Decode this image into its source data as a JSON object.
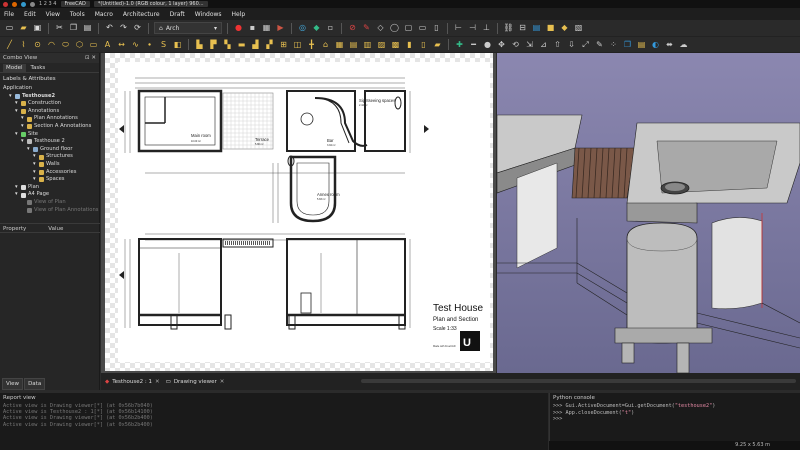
{
  "system_bar": {
    "workspace": "1 2 3 4",
    "tasks": [
      "FreeCAD",
      "*(Untitled)-1.0 (RGB colour, 1 layer) 960..."
    ]
  },
  "menu": [
    "File",
    "Edit",
    "View",
    "Tools",
    "Macro",
    "Architecture",
    "Draft",
    "Windows",
    "Help"
  ],
  "toolbar": {
    "workbench": "Arch"
  },
  "combo_view": {
    "title": "Combo View",
    "tabs": [
      "Model",
      "Tasks"
    ],
    "section": "Labels & Attributes",
    "tree": [
      {
        "label": "Application",
        "level": 0,
        "icon": "none",
        "state": ""
      },
      {
        "label": "Testhouse2",
        "level": 1,
        "icon": "document",
        "state": "sel-bold"
      },
      {
        "label": "Construction",
        "level": 2,
        "icon": "folder",
        "state": ""
      },
      {
        "label": "Annotations",
        "level": 2,
        "icon": "folder",
        "state": ""
      },
      {
        "label": "Plan Annotations",
        "level": 3,
        "icon": "folder",
        "state": ""
      },
      {
        "label": "Section A Annotations",
        "level": 3,
        "icon": "folder",
        "state": ""
      },
      {
        "label": "Site",
        "level": 2,
        "icon": "site",
        "state": ""
      },
      {
        "label": "Testhouse 2",
        "level": 3,
        "icon": "building",
        "state": ""
      },
      {
        "label": "Ground floor",
        "level": 4,
        "icon": "floor",
        "state": ""
      },
      {
        "label": "Structures",
        "level": 5,
        "icon": "folder",
        "state": ""
      },
      {
        "label": "Walls",
        "level": 5,
        "icon": "folder",
        "state": ""
      },
      {
        "label": "Accessories",
        "level": 5,
        "icon": "folder",
        "state": ""
      },
      {
        "label": "Spaces",
        "level": 5,
        "icon": "folder",
        "state": ""
      },
      {
        "label": "Plan",
        "level": 2,
        "icon": "plan",
        "state": ""
      },
      {
        "label": "A4 Page",
        "level": 2,
        "icon": "page",
        "state": ""
      },
      {
        "label": "View of Plan",
        "level": 3,
        "icon": "view",
        "state": "dim"
      },
      {
        "label": "View of Plan Annotations",
        "level": 3,
        "icon": "view",
        "state": "dim"
      }
    ],
    "property_headers": [
      "Property",
      "Value"
    ],
    "bottom_tabs": [
      "View",
      "Data"
    ]
  },
  "drawing": {
    "title": "Test House",
    "subtitle": "Plan and Section",
    "scale": "Scale 1:33",
    "footer": "Made with FreeCAD",
    "rooms": [
      "Main room",
      "Terrace",
      "Bar",
      "Annex room",
      "Sightseeing spaces"
    ],
    "room_areas": [
      "10.00 m²",
      "5.80 m²",
      "3.94 m²",
      "5.83 m²",
      "2.44 m²"
    ]
  },
  "doc_tabs": [
    "Testhouse2 : 1",
    "Drawing viewer"
  ],
  "report_view": {
    "title": "Report view",
    "lines": [
      "Active view is Drawing viewer[*] (at 0x56b7b040)",
      "Active view is Testhouse2 : 1[*] (at 0x56b14100)",
      "Active view is Drawing viewer[*] (at 0x56b2b400)",
      "Active view is Drawing viewer[*] (at 0x56b2b400)"
    ]
  },
  "python_console": {
    "title": "Python console",
    "lines": [
      {
        "prompt": ">>>",
        "code": "Gui.ActiveDocument=Gui.getDocument(",
        "str": "\"testhouse2\"",
        "tail": ")"
      },
      {
        "prompt": ">>>",
        "code": "App.closeDocument(",
        "str": "\"t\"",
        "tail": ")"
      },
      {
        "prompt": ">>>",
        "code": "",
        "str": "",
        "tail": ""
      }
    ]
  },
  "status": {
    "dimensions": "9.25 x 5.63 m"
  },
  "colors": {
    "selection": "#3e5f8a",
    "bg3d_top": "#8b87b0",
    "accent_string": "#e58aa5"
  }
}
